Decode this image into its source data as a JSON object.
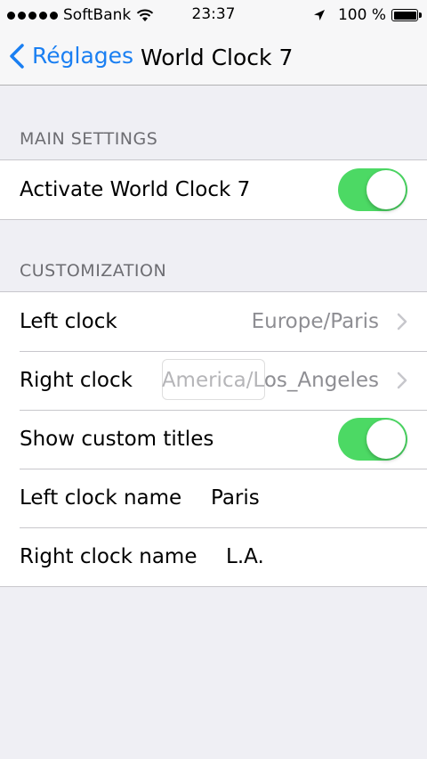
{
  "status_bar": {
    "carrier": "SoftBank",
    "time": "23:37",
    "battery_percent": "100 %",
    "battery_level": 1.0,
    "signal_bars": 5
  },
  "nav": {
    "back_label": "Réglages",
    "title": "World Clock 7"
  },
  "colors": {
    "accent": "#1a7ff2",
    "toggle_on": "#4cd964",
    "background": "#efeff4"
  },
  "sections": {
    "main": {
      "header": "MAIN SETTINGS",
      "activate_label": "Activate World Clock 7",
      "activate_on": true
    },
    "customization": {
      "header": "CUSTOMIZATION",
      "left_clock_label": "Left clock",
      "left_clock_value": "Europe/Paris",
      "right_clock_label": "Right clock",
      "right_clock_value": "America/Los_Angeles",
      "show_titles_label": "Show custom titles",
      "show_titles_on": true,
      "left_name_label": "Left clock name",
      "left_name_value": "Paris",
      "right_name_label": "Right clock name",
      "right_name_value": "L.A."
    }
  }
}
